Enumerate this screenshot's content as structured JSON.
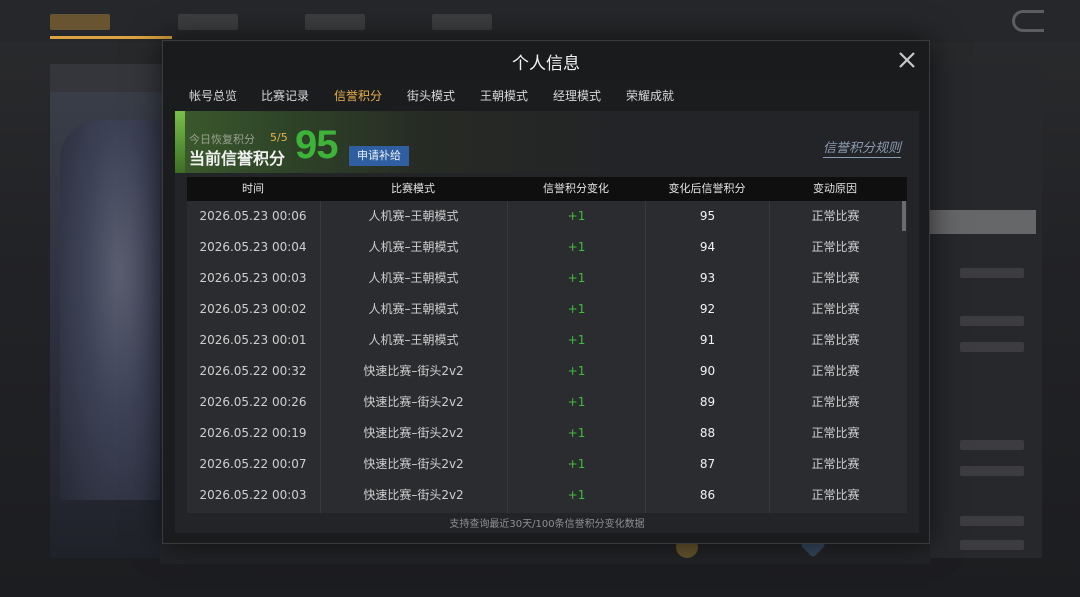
{
  "modal": {
    "title": "个人信息"
  },
  "tabs": [
    {
      "label": "帐号总览"
    },
    {
      "label": "比赛记录"
    },
    {
      "label": "信誉积分"
    },
    {
      "label": "街头模式"
    },
    {
      "label": "王朝模式"
    },
    {
      "label": "经理模式"
    },
    {
      "label": "荣耀成就"
    }
  ],
  "active_tab_index": 2,
  "credit": {
    "recover_label": "今日恢复积分",
    "recover_value": "5/5",
    "current_label": "当前信誉积分",
    "score": "95",
    "apply_button": "申请补给",
    "rules_link": "信誉积分规则"
  },
  "table": {
    "headers": [
      "时间",
      "比赛模式",
      "信誉积分变化",
      "变化后信誉积分",
      "变动原因"
    ],
    "rows": [
      {
        "time": "2026.05.23  00:06",
        "mode": "人机赛–王朝模式",
        "change": "+1",
        "after": "95",
        "reason": "正常比赛"
      },
      {
        "time": "2026.05.23  00:04",
        "mode": "人机赛–王朝模式",
        "change": "+1",
        "after": "94",
        "reason": "正常比赛"
      },
      {
        "time": "2026.05.23  00:03",
        "mode": "人机赛–王朝模式",
        "change": "+1",
        "after": "93",
        "reason": "正常比赛"
      },
      {
        "time": "2026.05.23  00:02",
        "mode": "人机赛–王朝模式",
        "change": "+1",
        "after": "92",
        "reason": "正常比赛"
      },
      {
        "time": "2026.05.23  00:01",
        "mode": "人机赛–王朝模式",
        "change": "+1",
        "after": "91",
        "reason": "正常比赛"
      },
      {
        "time": "2026.05.22  00:32",
        "mode": "快速比赛–街头2v2",
        "change": "+1",
        "after": "90",
        "reason": "正常比赛"
      },
      {
        "time": "2026.05.22  00:26",
        "mode": "快速比赛–街头2v2",
        "change": "+1",
        "after": "89",
        "reason": "正常比赛"
      },
      {
        "time": "2026.05.22  00:19",
        "mode": "快速比赛–街头2v2",
        "change": "+1",
        "after": "88",
        "reason": "正常比赛"
      },
      {
        "time": "2026.05.22  00:07",
        "mode": "快速比赛–街头2v2",
        "change": "+1",
        "after": "87",
        "reason": "正常比赛"
      },
      {
        "time": "2026.05.22  00:03",
        "mode": "快速比赛–街头2v2",
        "change": "+1",
        "after": "86",
        "reason": "正常比赛"
      }
    ],
    "footer_note": "支持查询最近30天/100条信誉积分变化数据"
  },
  "colors": {
    "accent": "#e9b24a",
    "score_green": "#3eb33a",
    "apply_button": "#2f5fa0"
  },
  "icons": {
    "close": "close-icon",
    "back": "back-arrow-icon"
  }
}
